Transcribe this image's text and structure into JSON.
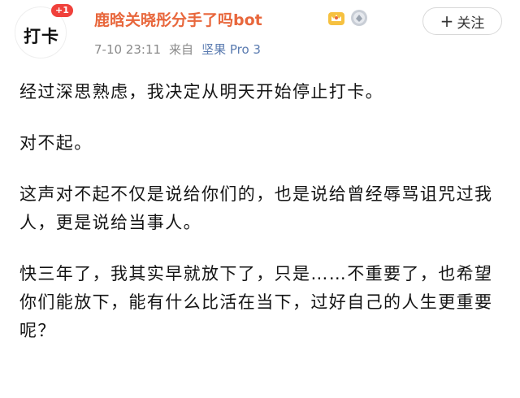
{
  "post": {
    "author": {
      "avatar_text": "打卡",
      "avatar_badge": "+1",
      "username": "鹿晗关晓彤分手了吗bot"
    },
    "meta": {
      "time": "7-10 23:11",
      "source_prefix": "来自",
      "source_app": "坚果 Pro 3"
    },
    "follow_button": {
      "icon": "plus-icon",
      "label": "关注",
      "plus": "+"
    },
    "paragraphs": [
      "经过深思熟虑，我决定从明天开始停止打卡。",
      "对不起。",
      "这声对不起不仅是说给你们的，也是说给曾经辱骂诅咒过我人，更是说给当事人。",
      "快三年了，我其实早就放下了，只是……不重要了，也希望你们能放下，能有什么比活在当下，过好自己的人生更重要呢？"
    ]
  },
  "icons": [
    "crown-icon",
    "medal-icon",
    "plus-icon"
  ],
  "colors": {
    "username": "#e8673c",
    "badge": "#f0413b",
    "meta": "#8a8a8a",
    "source_link": "#5a7bb0",
    "text": "#141414"
  }
}
